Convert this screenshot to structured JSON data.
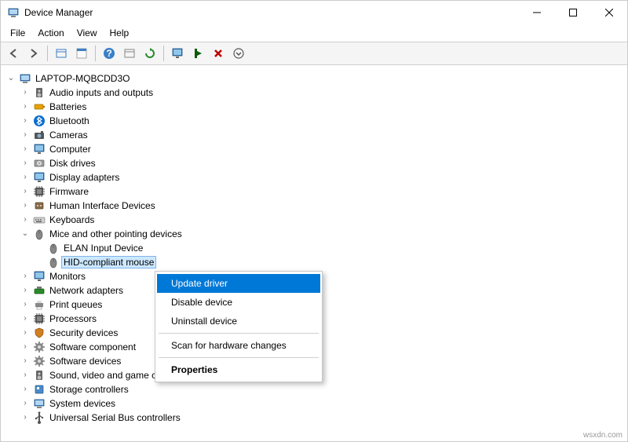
{
  "window": {
    "title": "Device Manager"
  },
  "menubar": {
    "file": "File",
    "action": "Action",
    "view": "View",
    "help": "Help"
  },
  "tree": {
    "root": "LAPTOP-MQBCDD3O",
    "items": {
      "audio": "Audio inputs and outputs",
      "batteries": "Batteries",
      "bluetooth": "Bluetooth",
      "cameras": "Cameras",
      "computer": "Computer",
      "diskdrives": "Disk drives",
      "displayadapters": "Display adapters",
      "firmware": "Firmware",
      "hid": "Human Interface Devices",
      "keyboards": "Keyboards",
      "mice": "Mice and other pointing devices",
      "mice_elan": "ELAN Input Device",
      "mice_hid": "HID-compliant mouse",
      "monitors": "Monitors",
      "netadapters": "Network adapters",
      "printqueues": "Print queues",
      "processors": "Processors",
      "securitydevices": "Security devices",
      "softwarecomponents": "Software component",
      "softwaredevices": "Software devices",
      "sound": "Sound, video and game controllers",
      "storagecontrollers": "Storage controllers",
      "systemdevices": "System devices",
      "usb": "Universal Serial Bus controllers"
    }
  },
  "contextmenu": {
    "update": "Update driver",
    "disable": "Disable device",
    "uninstall": "Uninstall device",
    "scan": "Scan for hardware changes",
    "properties": "Properties"
  },
  "watermark": "wsxdn.com"
}
